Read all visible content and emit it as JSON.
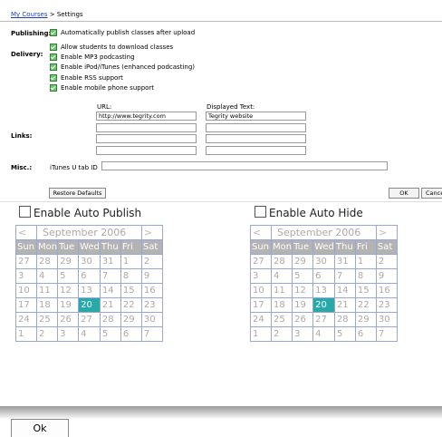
{
  "breadcrumb": {
    "link": "My Courses",
    "separator": " > ",
    "current": "Settings"
  },
  "publishing": {
    "label": "Publishing:",
    "option": "Automatically publish classes after upload"
  },
  "delivery": {
    "label": "Delivery:",
    "options": [
      "Allow students to download classes",
      "Enable MP3 podcasting",
      "Enable iPod/iTunes (enhanced podcasting)",
      "Enable RSS support",
      "Enable mobile phone support"
    ]
  },
  "links": {
    "label": "Links:",
    "url_header": "URL:",
    "text_header": "Displayed Text:",
    "rows": [
      {
        "url": "http://www.tegrity.com",
        "text": "Tegrity website"
      },
      {
        "url": "",
        "text": ""
      },
      {
        "url": "",
        "text": ""
      },
      {
        "url": "",
        "text": ""
      }
    ]
  },
  "misc": {
    "label": "Misc.:",
    "itunes_label": "iTunes U tab ID",
    "itunes_value": ""
  },
  "buttons": {
    "restore": "Restore Defaults",
    "ok": "OK",
    "cancel": "Cancel",
    "bottom_ok": "Ok"
  },
  "auto_publish": {
    "label": "Enable Auto Publish"
  },
  "auto_hide": {
    "label": "Enable Auto Hide"
  },
  "calendar": {
    "prev": "<",
    "next": ">",
    "month": "September 2006",
    "weekdays": [
      "Sun",
      "Mon",
      "Tue",
      "Wed",
      "Thu",
      "Fri",
      "Sat"
    ],
    "weeks": [
      [
        "27",
        "28",
        "29",
        "30",
        "31",
        "1",
        "2"
      ],
      [
        "3",
        "4",
        "5",
        "6",
        "7",
        "8",
        "9"
      ],
      [
        "10",
        "11",
        "12",
        "13",
        "14",
        "15",
        "16"
      ],
      [
        "17",
        "18",
        "19",
        "20",
        "21",
        "22",
        "23"
      ],
      [
        "24",
        "25",
        "26",
        "27",
        "28",
        "29",
        "30"
      ],
      [
        "1",
        "2",
        "3",
        "4",
        "5",
        "6",
        "7"
      ]
    ],
    "selected": "20",
    "selected_color": "#28a9a9"
  }
}
